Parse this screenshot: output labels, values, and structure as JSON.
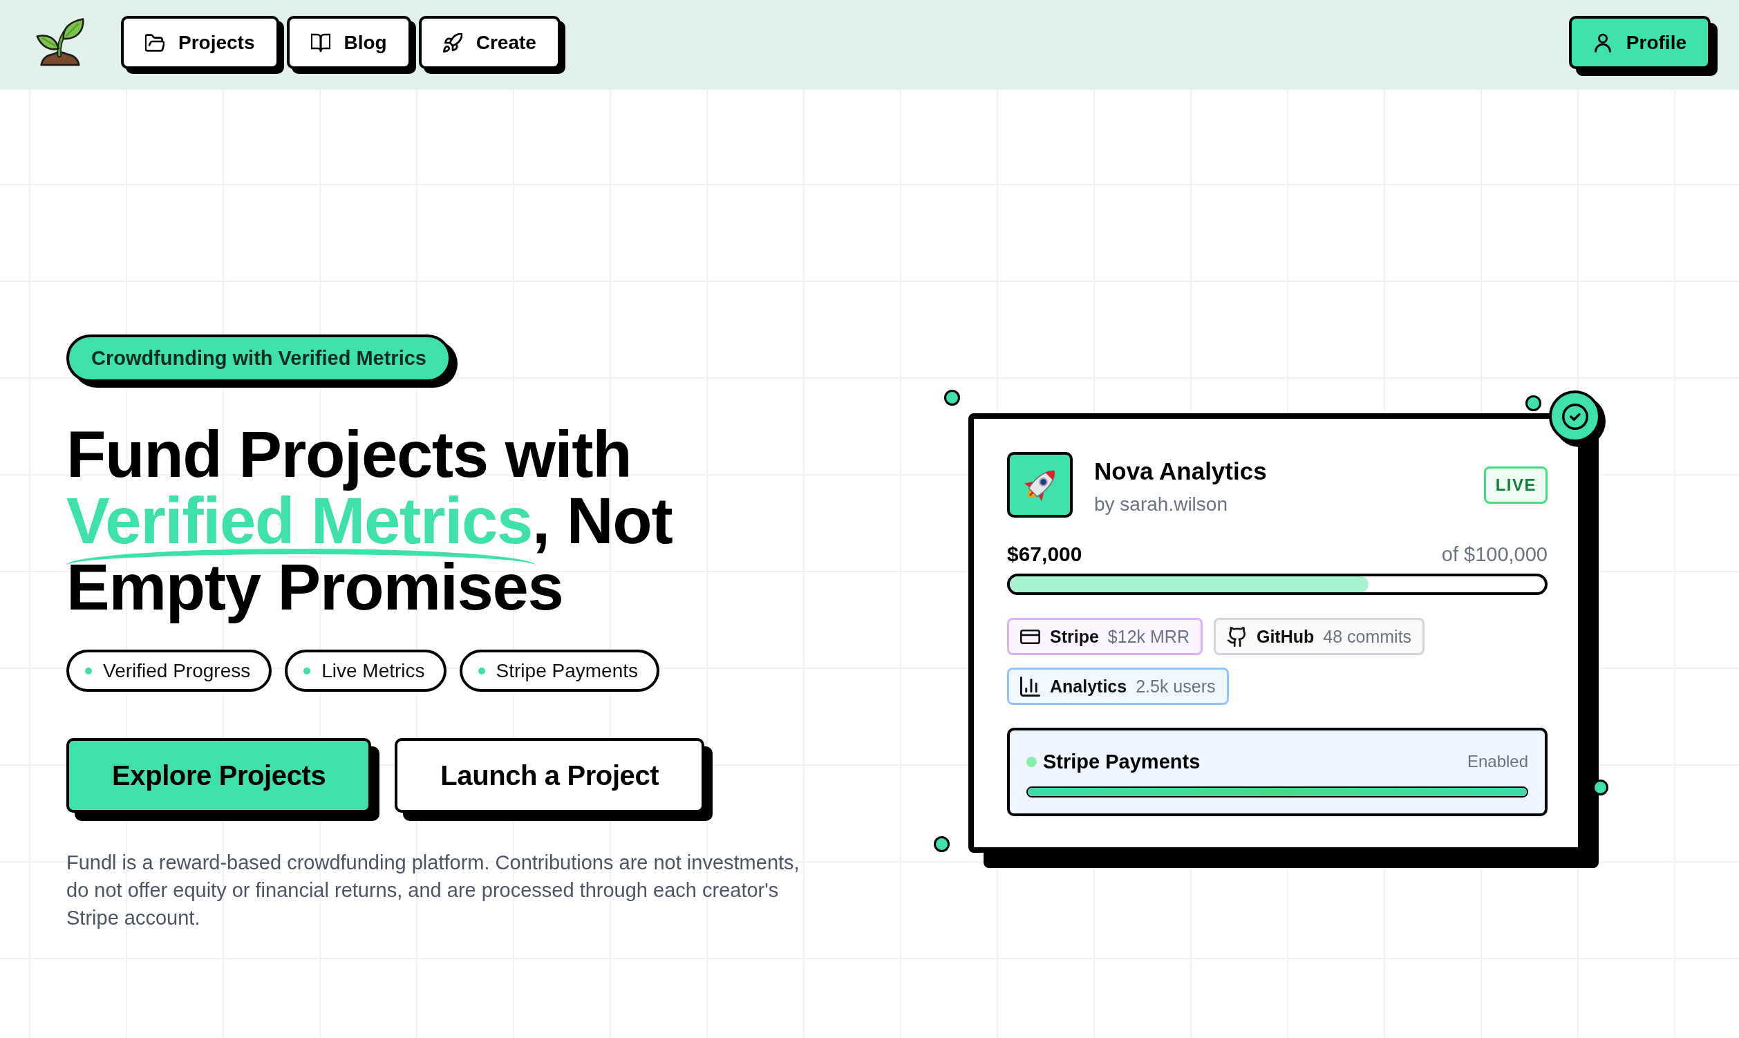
{
  "nav": {
    "links": [
      {
        "label": "Projects"
      },
      {
        "label": "Blog"
      },
      {
        "label": "Create"
      }
    ],
    "profile": {
      "label": "Profile"
    }
  },
  "hero": {
    "badge": "Crowdfunding with Verified Metrics",
    "headline": {
      "before": "Fund Projects with",
      "highlight": "Verified Metrics",
      "after": ", Not Empty Promises"
    },
    "features": [
      "Verified Progress",
      "Live Metrics",
      "Stripe Payments"
    ],
    "actions": [
      {
        "label": "Explore Projects",
        "kind": "primary"
      },
      {
        "label": "Launch a Project",
        "kind": "secondary"
      }
    ],
    "disclaimer": "Fundl is a reward-based crowdfunding platform. Contributions are not investments, do not offer equity or financial returns, and are processed through each creator's Stripe account."
  },
  "project_card": {
    "title": "Nova Analytics",
    "author": "by sarah.wilson",
    "status": "LIVE",
    "raised": "$67,000",
    "goal": "of $100,000",
    "level": 0.67,
    "metrics": [
      {
        "name": "Stripe",
        "value": "$12k MRR",
        "color": "#d8b4fe"
      },
      {
        "name": "GitHub",
        "value": "48 commits",
        "color": "#d1d5db"
      },
      {
        "name": "Analytics",
        "value": "2.5k users",
        "color": "#93c5fd"
      }
    ],
    "payments": {
      "label": "Stripe Payments",
      "status": "Enabled",
      "level": 1
    }
  }
}
